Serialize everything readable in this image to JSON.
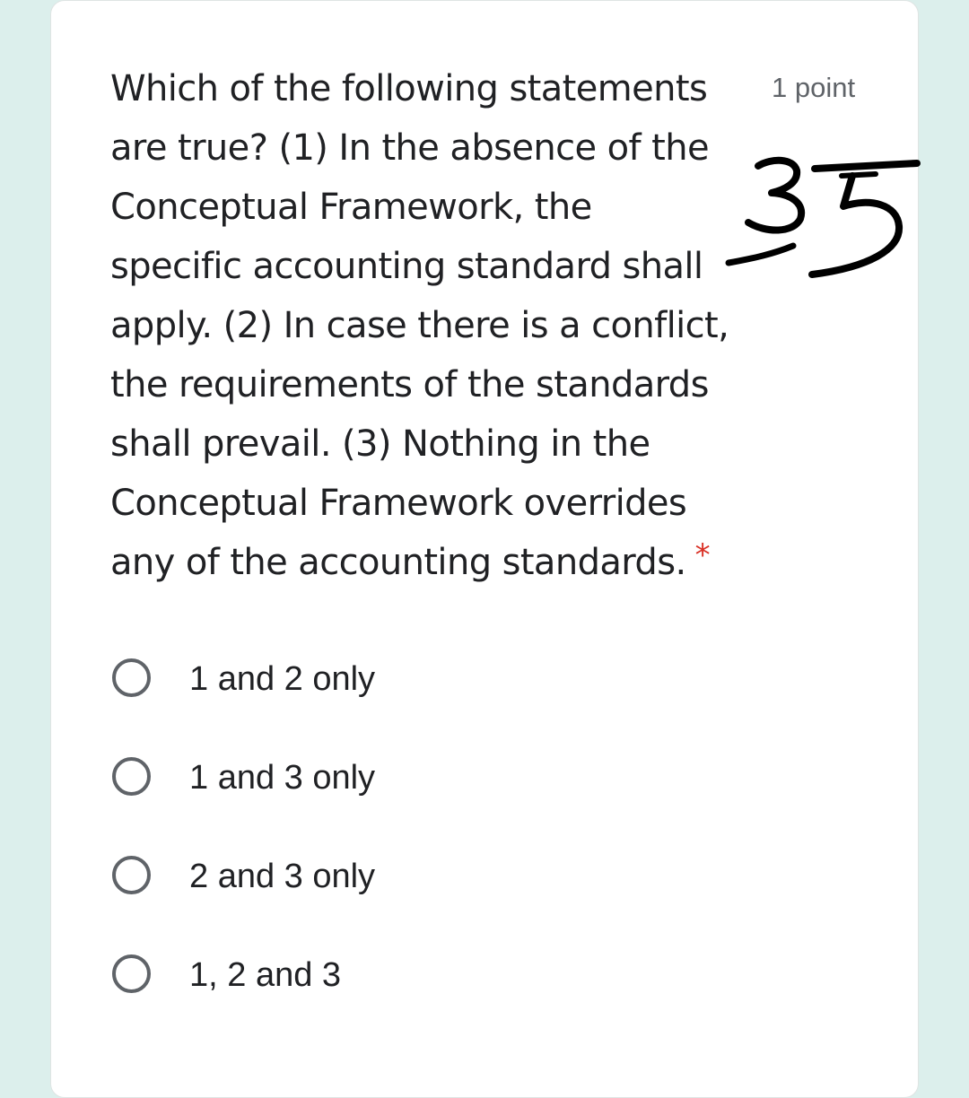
{
  "question": {
    "lines": [
      "Which of the following statements",
      "are true? (1) In the absence of the",
      "Conceptual Framework, the",
      "specific accounting standard shall",
      "apply. (2) In case there is a conflict,",
      "the requirements of the standards",
      "shall prevail. (3) Nothing in the",
      "Conceptual Framework overrides",
      "any of the accounting standards."
    ],
    "required_marker": "*",
    "points": "1 point"
  },
  "annotation": {
    "handwritten_text": "35"
  },
  "options": [
    {
      "label": "1 and 2 only",
      "selected": false
    },
    {
      "label": "1 and 3 only",
      "selected": false
    },
    {
      "label": "2 and 3 only",
      "selected": false
    },
    {
      "label": "1, 2 and 3",
      "selected": false
    }
  ],
  "colors": {
    "background": "#dcefec",
    "card": "#ffffff",
    "text": "#202124",
    "secondary_text": "#5f6368",
    "required": "#d93025"
  }
}
